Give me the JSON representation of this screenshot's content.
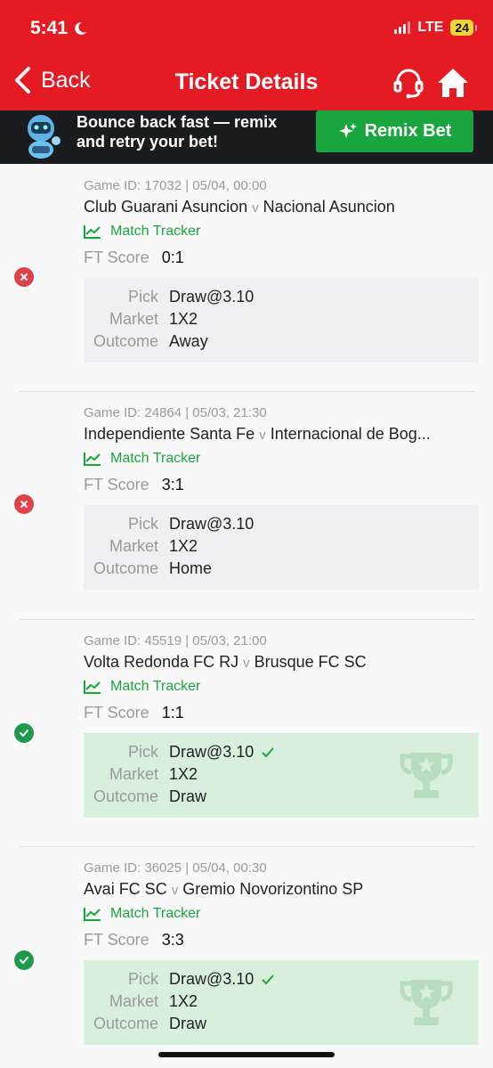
{
  "status_bar": {
    "time": "5:41",
    "network": "LTE",
    "battery": "24"
  },
  "nav": {
    "back_label": "Back",
    "title": "Ticket Details",
    "support_icon": "headset-icon",
    "home_icon": "home-icon"
  },
  "banner": {
    "text": "Bounce back fast — remix and retry your bet!",
    "button_label": "Remix Bet"
  },
  "colors": {
    "brand_red": "#e41b23",
    "green": "#1aa63e",
    "lost": "#e0404a",
    "win_bg": "#d8efdc"
  },
  "tickets": [
    {
      "result": "lost",
      "game_line": "Game ID: 17032 | 05/04, 00:00",
      "home": "Club Guarani Asuncion",
      "vs": "v",
      "away": "Nacional Asuncion",
      "tracker": "Match Tracker",
      "score_label": "FT Score",
      "score": "0:1",
      "pick_label": "Pick",
      "pick": "Draw@3.10",
      "market_label": "Market",
      "market": "1X2",
      "outcome_label": "Outcome",
      "outcome": "Away"
    },
    {
      "result": "lost",
      "game_line": "Game ID: 24864 | 05/03, 21:30",
      "home": "Independiente Santa Fe",
      "vs": "v",
      "away": "Internacional de Bog...",
      "tracker": "Match Tracker",
      "score_label": "FT Score",
      "score": "3:1",
      "pick_label": "Pick",
      "pick": "Draw@3.10",
      "market_label": "Market",
      "market": "1X2",
      "outcome_label": "Outcome",
      "outcome": "Home"
    },
    {
      "result": "won",
      "game_line": "Game ID: 45519 | 05/03, 21:00",
      "home": "Volta Redonda FC RJ",
      "vs": "v",
      "away": "Brusque FC SC",
      "tracker": "Match Tracker",
      "score_label": "FT Score",
      "score": "1:1",
      "pick_label": "Pick",
      "pick": "Draw@3.10",
      "market_label": "Market",
      "market": "1X2",
      "outcome_label": "Outcome",
      "outcome": "Draw"
    },
    {
      "result": "won",
      "game_line": "Game ID: 36025 | 05/04, 00:30",
      "home": "Avai FC SC",
      "vs": "v",
      "away": "Gremio Novorizontino SP",
      "tracker": "Match Tracker",
      "score_label": "FT Score",
      "score": "3:3",
      "pick_label": "Pick",
      "pick": "Draw@3.10",
      "market_label": "Market",
      "market": "1X2",
      "outcome_label": "Outcome",
      "outcome": "Draw"
    }
  ]
}
